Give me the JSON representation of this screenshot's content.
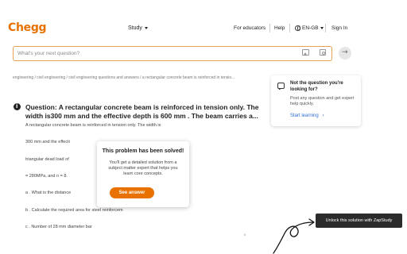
{
  "header": {
    "logo": "Chegg",
    "study": "Study",
    "educators": "For educators",
    "help": "Help",
    "lang": "EN-GB",
    "signin": "Sign In"
  },
  "search": {
    "placeholder": "What's your next question?"
  },
  "breadcrumb": "engineering / civil engineering / civil engineering questions and answers / a rectangular concrete beam is reinforced in tensio...",
  "side_card": {
    "title": "Not the question you're looking for?",
    "text": "Post any question and get expert help quickly.",
    "link": "Start learning"
  },
  "question": {
    "title": "Question: A rectangular concrete beam is reinforced in tension only. The width is300 mm and the effective depth is 600 mm . The beam carries a...",
    "lines": [
      "A rectangular concrete beam is reinforced in tension only. The width is",
      "300 mm and the effecti",
      "triangular dead load of",
      "= 280MPa, and n = 8.",
      "a . What is the distance",
      "b . Calculate the required area for steel reinforcem",
      "c . Number of 28 mm diameter bar"
    ]
  },
  "modal": {
    "title": "This problem has been solved!",
    "text": "You'll get a detailed solution from a subject matter expert that helps you learn core concepts.",
    "button": "See answer"
  },
  "page_mark": "8",
  "zapstudy": {
    "button": "Unlock this solution with ZapStudy"
  },
  "colors": {
    "brand": "#e87100",
    "link": "#2f6fd8",
    "zap_bg": "#2b2b2b"
  }
}
